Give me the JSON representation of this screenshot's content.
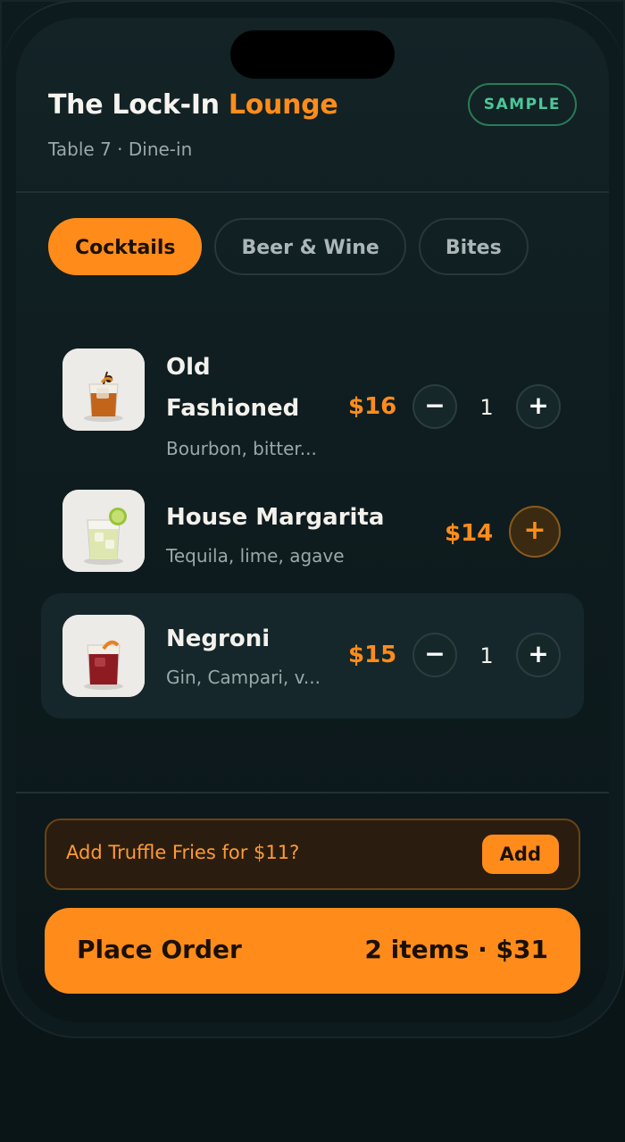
{
  "venue": {
    "name_main": "The Lock-In",
    "name_accent": "Lounge",
    "subtitle": "Table 7 · Dine-in",
    "badge": "SAMPLE"
  },
  "tabs": [
    {
      "label": "Cocktails",
      "active": true
    },
    {
      "label": "Beer & Wine",
      "active": false
    },
    {
      "label": "Bites",
      "active": false
    }
  ],
  "items": [
    {
      "name_line1": "Old",
      "name_line2": "Fashioned",
      "desc": "Bourbon, bitter...",
      "price": "$16",
      "qty": "1",
      "minus": "−",
      "plus": "+"
    },
    {
      "name": "House Margarita",
      "desc": "Tequila, lime, agave",
      "price": "$14",
      "plus": "+"
    },
    {
      "name": "Negroni",
      "desc": "Gin, Campari, v...",
      "price": "$15",
      "qty": "1",
      "minus": "−",
      "plus": "+"
    }
  ],
  "upsell": {
    "text": "Add Truffle Fries for $11?",
    "button": "Add"
  },
  "order": {
    "label": "Place Order",
    "summary": "2 items · $31"
  },
  "colors": {
    "accent": "#ff8c1a",
    "badge_green": "#4cc79a",
    "background": "#0f1d20"
  }
}
